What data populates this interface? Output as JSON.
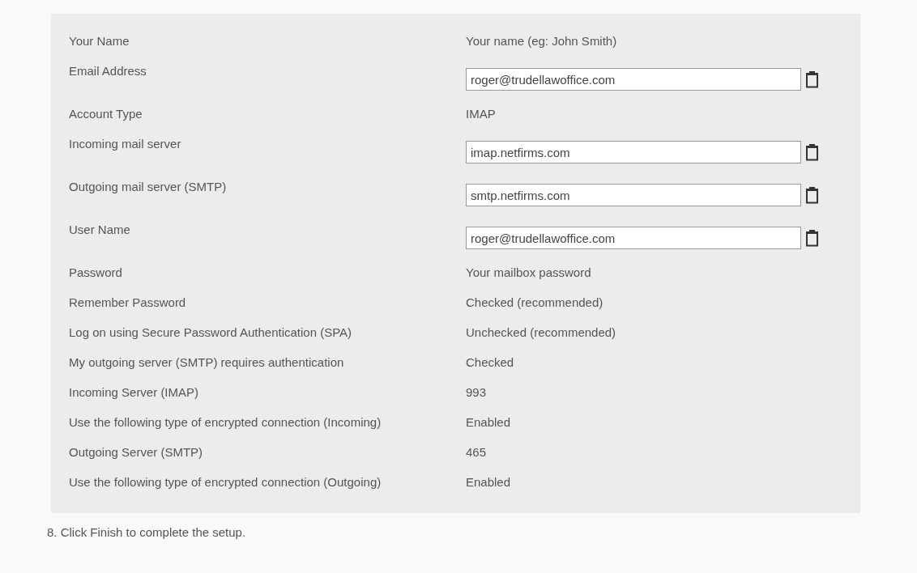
{
  "settings": [
    {
      "label": "Your Name",
      "kind": "text",
      "value": "Your name (eg: John Smith)"
    },
    {
      "label": "Email Address",
      "kind": "field",
      "value": "roger@trudellawoffice.com"
    },
    {
      "label": "Account Type",
      "kind": "text",
      "value": "IMAP"
    },
    {
      "label": "Incoming mail server",
      "kind": "field",
      "value": "imap.netfirms.com"
    },
    {
      "label": "Outgoing mail server (SMTP)",
      "kind": "field",
      "value": "smtp.netfirms.com"
    },
    {
      "label": "User Name",
      "kind": "field",
      "value": "roger@trudellawoffice.com"
    },
    {
      "label": "Password",
      "kind": "text",
      "value": "Your mailbox password"
    },
    {
      "label": "Remember Password",
      "kind": "text",
      "value": "Checked (recommended)"
    },
    {
      "label": "Log on using Secure Password Authentication (SPA)",
      "kind": "text",
      "value": "Unchecked (recommended)"
    },
    {
      "label": "My outgoing server (SMTP) requires authentication",
      "kind": "text",
      "value": "Checked"
    },
    {
      "label": "Incoming Server (IMAP)",
      "kind": "text",
      "value": "993"
    },
    {
      "label": "Use the following type of encrypted connection (Incoming)",
      "kind": "text",
      "value": "Enabled"
    },
    {
      "label": "Outgoing Server (SMTP)",
      "kind": "text",
      "value": "465"
    },
    {
      "label": "Use the following type of encrypted connection (Outgoing)",
      "kind": "text",
      "value": "Enabled"
    }
  ],
  "step": "8. Click Finish to complete the setup."
}
